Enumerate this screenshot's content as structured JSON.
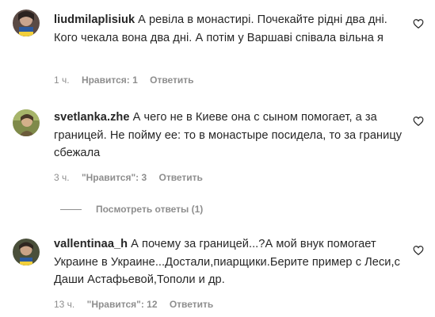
{
  "comments": [
    {
      "username": "liudmilaplisiuk",
      "text": "А ревіла в монастирі. Почекайте рідні два дні. Кого чекала вона два дні. А потім у Варшаві співала вільна я",
      "time": "1 ч.",
      "likes": "Нравится: 1",
      "reply": "Ответить"
    },
    {
      "username": "svetlanka.zhe",
      "text": "А чего не в Киеве она с сыном помогает, а за границей. Не пойму ее: то в монастыре посидела, то за границу сбежала",
      "time": "3 ч.",
      "likes": "\"Нравится\": 3",
      "reply": "Ответить",
      "view_replies": "Посмотреть ответы (1)"
    },
    {
      "username": "vallentinaa_h",
      "text": "А почему за границей...?А мой внук помогает Украине в Украине...Достали,пиарщики.Берите пример с Леси,с Даши Астафьевой,Тополи и др.",
      "time": "13 ч.",
      "likes": "\"Нравится\": 12",
      "reply": "Ответить"
    }
  ],
  "colors": {
    "text": "#262626",
    "muted": "#8e8e8e",
    "background": "#ffffff"
  },
  "icons": {
    "like": "heart-outline-icon"
  }
}
